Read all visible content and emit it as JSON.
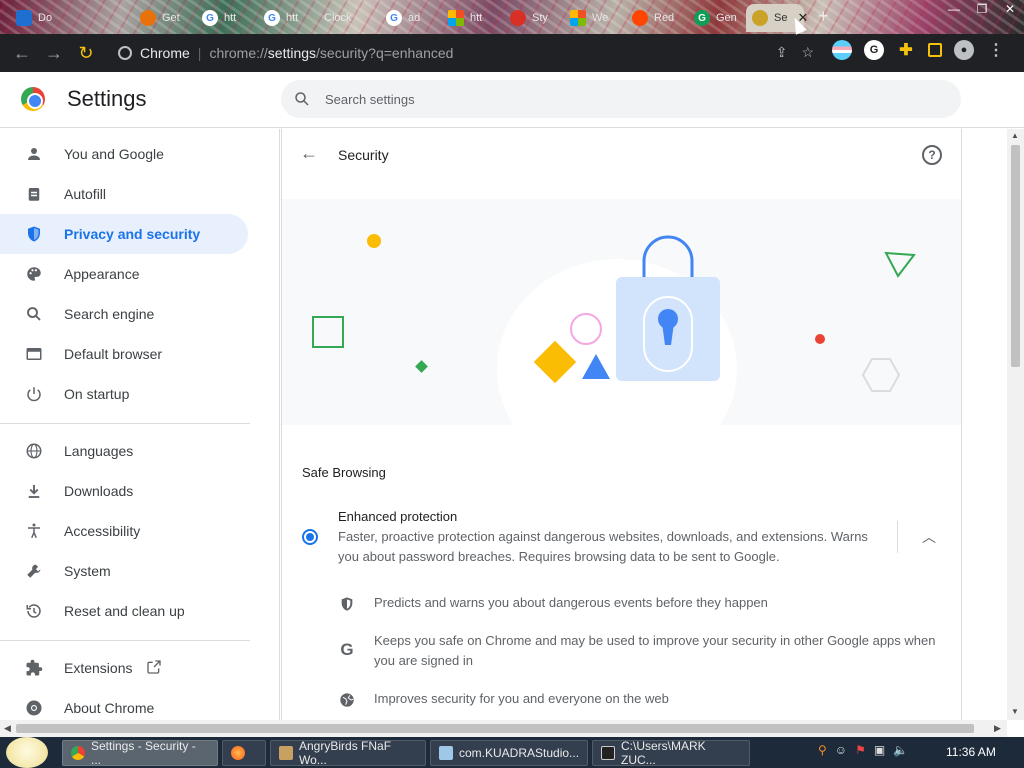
{
  "tabs": [
    {
      "label": "Do",
      "favicon": "windows-icon",
      "color": "#1f6fd1"
    },
    {
      "label": "Get",
      "favicon": "orange-circle-icon",
      "color": "#e8710a"
    },
    {
      "label": "htt",
      "favicon": "google-icon",
      "color": "#4285f4"
    },
    {
      "label": "htt",
      "favicon": "google-icon",
      "color": "#4285f4"
    },
    {
      "label": "Clock",
      "favicon": "clock-icon",
      "color": "#888888"
    },
    {
      "label": "ad",
      "favicon": "google-icon",
      "color": "#4285f4"
    },
    {
      "label": "htt",
      "favicon": "microsoft-icon",
      "color": "#f25022"
    },
    {
      "label": "Sty",
      "favicon": "red-logo-icon",
      "color": "#d93025"
    },
    {
      "label": "We",
      "favicon": "microsoft-icon",
      "color": "#7fba00"
    },
    {
      "label": "Red",
      "favicon": "reddit-icon",
      "color": "#ff4500"
    },
    {
      "label": "Gen",
      "favicon": "green-circle-icon",
      "color": "#0f9d58"
    },
    {
      "label": "Se",
      "favicon": "settings-gear-icon",
      "color": "#c9a227"
    }
  ],
  "omnibox": {
    "site": "Chrome",
    "host": "chrome://",
    "path_bold": "settings",
    "path_rest": "/security?q=enhanced"
  },
  "header": {
    "title": "Settings",
    "search_placeholder": "Search settings"
  },
  "sidebar": {
    "items": [
      {
        "label": "You and Google",
        "icon": "person-icon"
      },
      {
        "label": "Autofill",
        "icon": "clipboard-icon"
      },
      {
        "label": "Privacy and security",
        "icon": "shield-icon",
        "active": true
      },
      {
        "label": "Appearance",
        "icon": "palette-icon"
      },
      {
        "label": "Search engine",
        "icon": "search-icon"
      },
      {
        "label": "Default browser",
        "icon": "browser-icon"
      },
      {
        "label": "On startup",
        "icon": "power-icon"
      },
      {
        "label": "Languages",
        "icon": "globe-icon"
      },
      {
        "label": "Downloads",
        "icon": "download-icon"
      },
      {
        "label": "Accessibility",
        "icon": "accessibility-icon"
      },
      {
        "label": "System",
        "icon": "wrench-icon"
      },
      {
        "label": "Reset and clean up",
        "icon": "history-icon"
      },
      {
        "label": "Extensions",
        "icon": "puzzle-icon"
      },
      {
        "label": "About Chrome",
        "icon": "chrome-icon"
      }
    ]
  },
  "main": {
    "title": "Security",
    "section_title": "Safe Browsing",
    "option": {
      "title": "Enhanced protection",
      "description": "Faster, proactive protection against dangerous websites, downloads, and extensions. Warns you about password breaches. Requires browsing data to be sent to Google."
    },
    "details": [
      {
        "text": "Predicts and warns you about dangerous events before they happen",
        "icon": "shield-icon"
      },
      {
        "text": "Keeps you safe on Chrome and may be used to improve your security in other Google apps when you are signed in",
        "icon": "google-g-icon"
      },
      {
        "text": "Improves security for you and everyone on the web",
        "icon": "globe-icon"
      }
    ]
  },
  "taskbar": {
    "tasks": [
      {
        "label": "Settings - Security - ...",
        "icon": "chrome-icon",
        "active": true
      },
      {
        "label": "",
        "icon": "firefox-icon"
      },
      {
        "label": "AngryBirds FNaF Wo...",
        "icon": "document-icon"
      },
      {
        "label": "com.KUADRAStudio...",
        "icon": "notepad-icon"
      },
      {
        "label": "C:\\Users\\MARK ZUC...",
        "icon": "7zip-icon"
      }
    ],
    "clock": "11:36 AM"
  },
  "colors": {
    "accent": "#1a73e8",
    "active_bg": "#e8f0fe",
    "toolbar": "#202124"
  }
}
